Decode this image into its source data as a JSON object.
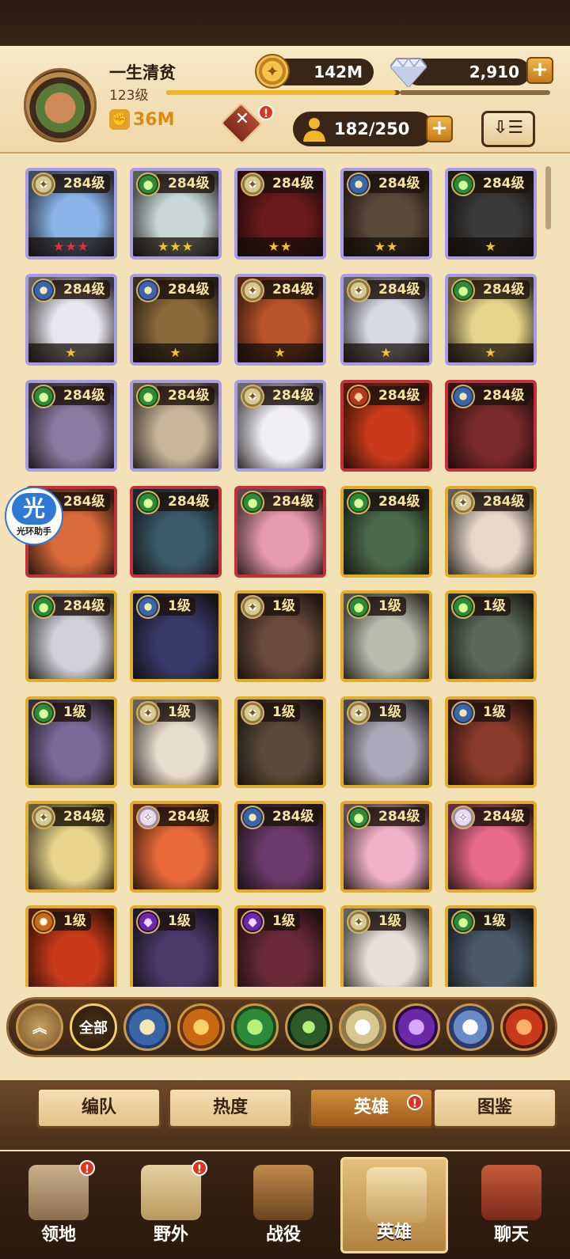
{
  "player": {
    "name": "一生清贫",
    "level": "123级",
    "power": "36M"
  },
  "resources": {
    "gold": "142M",
    "gems": "2,910",
    "hero_count": "182/250"
  },
  "colors": {
    "accent": "#f2b52a",
    "badge": "#e0321e",
    "frame_purple": "#a89be6",
    "frame_red": "#c4303a",
    "frame_gold": "#e0ad2a"
  },
  "heroes": [
    {
      "level": "284级",
      "frame": "purple",
      "faction": "celestial",
      "stars": "★★★",
      "star_color": "#e03040",
      "bg": "#8ab4e8"
    },
    {
      "level": "284级",
      "frame": "purple",
      "faction": "wilder",
      "stars": "★★★",
      "star_color": "#f2c234",
      "bg": "#c8d6d6"
    },
    {
      "level": "284级",
      "frame": "purple",
      "faction": "celestial",
      "stars": "★★",
      "star_color": "#f2c234",
      "bg": "#6a1a1a"
    },
    {
      "level": "284级",
      "frame": "purple",
      "faction": "lightbearer",
      "stars": "★★",
      "star_color": "#f2c234",
      "bg": "#5a4a3a"
    },
    {
      "level": "284级",
      "frame": "purple",
      "faction": "wilder",
      "stars": "★",
      "star_color": "#f2c234",
      "bg": "#3a3a3a"
    },
    {
      "level": "284级",
      "frame": "purple",
      "faction": "lightbearer",
      "stars": "★",
      "star_color": "#f2c234",
      "bg": "#e8e6f0"
    },
    {
      "level": "284级",
      "frame": "purple",
      "faction": "lightbearer",
      "stars": "★",
      "star_color": "#f2c234",
      "bg": "#8a6a3a"
    },
    {
      "level": "284级",
      "frame": "purple",
      "faction": "celestial",
      "stars": "★",
      "star_color": "#f2c234",
      "bg": "#b8542a"
    },
    {
      "level": "284级",
      "frame": "purple",
      "faction": "celestial",
      "stars": "★",
      "star_color": "#f2c234",
      "bg": "#d6dae6"
    },
    {
      "level": "284级",
      "frame": "purple",
      "faction": "wilder",
      "stars": "★",
      "star_color": "#f2c234",
      "bg": "#e6d48a"
    },
    {
      "level": "284级",
      "frame": "purple",
      "faction": "wilder",
      "stars": "",
      "star_color": "#f2c234",
      "bg": "#8a7aa0"
    },
    {
      "level": "284级",
      "frame": "purple",
      "faction": "wilder",
      "stars": "",
      "star_color": "#f2c234",
      "bg": "#c8b49a"
    },
    {
      "level": "284级",
      "frame": "purple",
      "faction": "celestial",
      "stars": "",
      "star_color": "#f2c234",
      "bg": "#f0eef4"
    },
    {
      "level": "284级",
      "frame": "red",
      "faction": "graveborn",
      "stars": "",
      "star_color": "#f2c234",
      "bg": "#c83a1a"
    },
    {
      "level": "284级",
      "frame": "red",
      "faction": "lightbearer",
      "stars": "",
      "star_color": "#f2c234",
      "bg": "#7a2a2a"
    },
    {
      "level": "284级",
      "frame": "red",
      "faction": "graveborn",
      "stars": "",
      "star_color": "#f2c234",
      "bg": "#d86a3a"
    },
    {
      "level": "284级",
      "frame": "red",
      "faction": "wilder",
      "stars": "",
      "star_color": "#f2c234",
      "bg": "#3a5a6a"
    },
    {
      "level": "284级",
      "frame": "red",
      "faction": "wilder",
      "stars": "",
      "star_color": "#f2c234",
      "bg": "#e89ab0"
    },
    {
      "level": "284级",
      "frame": "gold",
      "faction": "wilder",
      "stars": "",
      "star_color": "#f2c234",
      "bg": "#4a6a4a"
    },
    {
      "level": "284级",
      "frame": "gold",
      "faction": "celestial",
      "stars": "",
      "star_color": "#f2c234",
      "bg": "#e8d8c8"
    },
    {
      "level": "284级",
      "frame": "gold",
      "faction": "wilder",
      "stars": "",
      "star_color": "#f2c234",
      "bg": "#d0d0d8"
    },
    {
      "level": "1级",
      "frame": "gold",
      "faction": "lightbearer",
      "stars": "",
      "star_color": "#f2c234",
      "bg": "#3a3a6a"
    },
    {
      "level": "1级",
      "frame": "gold",
      "faction": "celestial",
      "stars": "",
      "star_color": "#f2c234",
      "bg": "#6a4a3a"
    },
    {
      "level": "1级",
      "frame": "gold",
      "faction": "wilder",
      "stars": "",
      "star_color": "#f2c234",
      "bg": "#b8bcaa"
    },
    {
      "level": "1级",
      "frame": "gold",
      "faction": "wilder",
      "stars": "",
      "star_color": "#f2c234",
      "bg": "#5a6a5a"
    },
    {
      "level": "1级",
      "frame": "gold",
      "faction": "wilder",
      "stars": "",
      "star_color": "#f2c234",
      "bg": "#7a6a9a"
    },
    {
      "level": "1级",
      "frame": "gold",
      "faction": "celestial",
      "stars": "",
      "star_color": "#f2c234",
      "bg": "#e8dccc"
    },
    {
      "level": "1级",
      "frame": "gold",
      "faction": "celestial",
      "stars": "",
      "star_color": "#f2c234",
      "bg": "#5a4a3a"
    },
    {
      "level": "1级",
      "frame": "gold",
      "faction": "celestial",
      "stars": "",
      "star_color": "#f2c234",
      "bg": "#aaa8b8"
    },
    {
      "level": "1级",
      "frame": "gold",
      "faction": "lightbearer",
      "stars": "",
      "star_color": "#f2c234",
      "bg": "#8a3a2a"
    },
    {
      "level": "284级",
      "frame": "gold",
      "faction": "celestial",
      "stars": "",
      "star_color": "#f2c234",
      "bg": "#e8d48a"
    },
    {
      "level": "284级",
      "frame": "gold",
      "faction": "dimensional",
      "stars": "",
      "star_color": "#f2c234",
      "bg": "#e86a3a"
    },
    {
      "level": "284级",
      "frame": "gold",
      "faction": "lightbearer",
      "stars": "",
      "star_color": "#f2c234",
      "bg": "#6a3a6a"
    },
    {
      "level": "284级",
      "frame": "gold",
      "faction": "wilder",
      "stars": "",
      "star_color": "#f2c234",
      "bg": "#f0b0c8"
    },
    {
      "level": "284级",
      "frame": "gold",
      "faction": "dimensional",
      "stars": "",
      "star_color": "#f2c234",
      "bg": "#e86a8a"
    },
    {
      "level": "1级",
      "frame": "gold",
      "faction": "mauler",
      "stars": "",
      "star_color": "#f2c234",
      "bg": "#c83a1a"
    },
    {
      "level": "1级",
      "frame": "gold",
      "faction": "hypogean",
      "stars": "",
      "star_color": "#f2c234",
      "bg": "#4a3a6a"
    },
    {
      "level": "1级",
      "frame": "gold",
      "faction": "hypogean",
      "stars": "",
      "star_color": "#f2c234",
      "bg": "#6a2a3a"
    },
    {
      "level": "1级",
      "frame": "gold",
      "faction": "celestial",
      "stars": "",
      "star_color": "#f2c234",
      "bg": "#e8e0d8"
    },
    {
      "level": "1级",
      "frame": "gold",
      "faction": "wilder",
      "stars": "",
      "star_color": "#f2c234",
      "bg": "#4a5a6a"
    }
  ],
  "floating_helper": {
    "icon_char": "光",
    "label": "光环助手"
  },
  "filters": [
    {
      "name": "collapse",
      "label": "︽"
    },
    {
      "name": "all",
      "label": "全部"
    },
    {
      "name": "lightbearer",
      "label": ""
    },
    {
      "name": "mauler",
      "label": ""
    },
    {
      "name": "wilder",
      "label": ""
    },
    {
      "name": "graveborn",
      "label": ""
    },
    {
      "name": "celestial",
      "label": ""
    },
    {
      "name": "hypogean",
      "label": ""
    },
    {
      "name": "dimensional",
      "label": ""
    },
    {
      "name": "dragon",
      "label": ""
    }
  ],
  "subtabs": [
    "编队",
    "热度",
    "英雄",
    "图鉴"
  ],
  "nav": [
    "领地",
    "野外",
    "战役",
    "英雄",
    "聊天"
  ]
}
